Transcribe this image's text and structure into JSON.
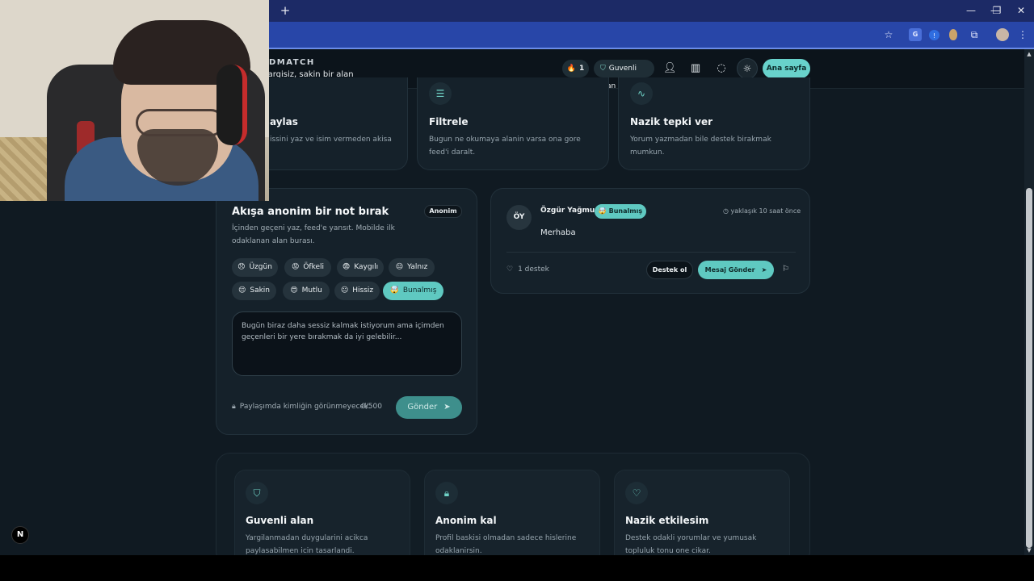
{
  "browser": {
    "new_tab": "+",
    "window_controls": [
      "—",
      "❐",
      "✕"
    ],
    "toolbar_icons": [
      "star-icon",
      "translate-icon",
      "extension-icon",
      "extension-icon",
      "puzzle-icon",
      "profile-icon",
      "menu-icon"
    ]
  },
  "header": {
    "brand": "DMATCH",
    "tagline": "n, yargisiz, sakin bir alan",
    "streak_count": "1",
    "safe_label": "Guvenli alan",
    "home_button": "Ana sayfa"
  },
  "top_cards": [
    {
      "icon": "edit-icon",
      "title": "aylas",
      "text": "issini yaz ve isim vermeden akisa"
    },
    {
      "icon": "sliders-icon",
      "title": "Filtrele",
      "text": "Bugun ne okumaya alanin varsa ona gore feed'i daralt."
    },
    {
      "icon": "pulse-icon",
      "title": "Nazik tepki ver",
      "text": "Yorum yazmadan bile destek birakmak mumkun."
    }
  ],
  "compose": {
    "title": "Akışa anonim bir not bırak",
    "badge": "Anonim",
    "subtitle": "İçinden geçeni yaz, feed'e yansıt. Mobilde ilk odaklanan alan burası.",
    "moods": [
      {
        "emoji": "😞",
        "label": "Üzgün"
      },
      {
        "emoji": "😡",
        "label": "Öfkeli"
      },
      {
        "emoji": "😨",
        "label": "Kaygılı"
      },
      {
        "emoji": "😔",
        "label": "Yalnız"
      },
      {
        "emoji": "😌",
        "label": "Sakin"
      },
      {
        "emoji": "😍",
        "label": "Mutlu"
      },
      {
        "emoji": "😐",
        "label": "Hissiz"
      },
      {
        "emoji": "🤯",
        "label": "Bunalmış"
      }
    ],
    "active_mood": "Bunalmış",
    "placeholder": "Bugün biraz daha sessiz kalmak istiyorum ama içimden geçenleri bir yere bırakmak da iyi gelebilir...",
    "privacy_note": "Paylaşımda kimliğin görünmeyecek.",
    "counter": "0/500",
    "send_label": "Gönder"
  },
  "post": {
    "avatar": "ÖY",
    "author": "Özgür Yağmur",
    "mood": "🤯 Bunalmış",
    "time": "yaklaşık 10 saat önce",
    "body": "Merhaba",
    "supports": "1 destek",
    "support_button": "Destek ol",
    "message_button": "Mesaj Gönder"
  },
  "features": [
    {
      "icon": "shield-check-icon",
      "title": "Guvenli alan",
      "text": "Yargilanmadan duygularini acikca paylasabilmen icin tasarlandi."
    },
    {
      "icon": "lock-icon",
      "title": "Anonim kal",
      "text": "Profil baskisi olmadan sadece hislerine odaklanirsin."
    },
    {
      "icon": "heart-icon",
      "title": "Nazik etkilesim",
      "text": "Destek odakli yorumlar ve yumusak topluluk tonu one cikar."
    }
  ],
  "next_badge": "N",
  "colors": {
    "accent": "#5fc9c1",
    "background": "#101a22",
    "card": "#15212a",
    "browser_toolbar": "#2846a8"
  }
}
